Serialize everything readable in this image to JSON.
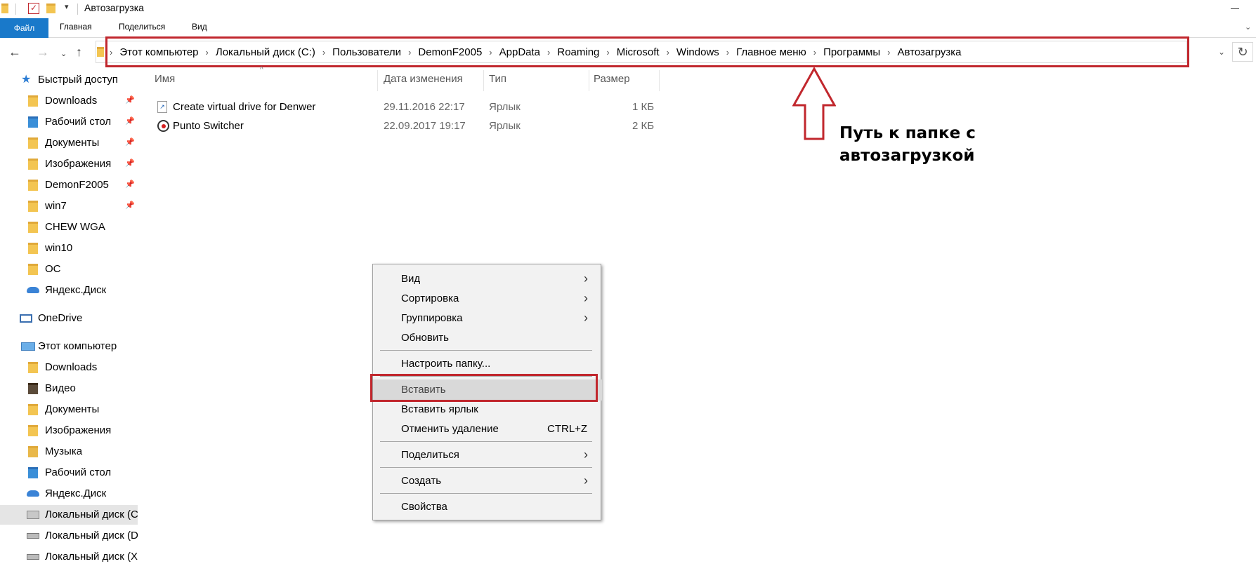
{
  "window": {
    "title": "Автозагрузка"
  },
  "ribbon": {
    "tabs": [
      "Файл",
      "Главная",
      "Поделиться",
      "Вид"
    ]
  },
  "address": {
    "crumbs": [
      "Этот компьютер",
      "Локальный диск (C:)",
      "Пользователи",
      "DemonF2005",
      "AppData",
      "Roaming",
      "Microsoft",
      "Windows",
      "Главное меню",
      "Программы",
      "Автозагрузка"
    ]
  },
  "sidebar": {
    "quick_access": "Быстрый доступ",
    "quick_items": [
      {
        "label": "Downloads",
        "icon": "download-folder-icon",
        "pinned": true
      },
      {
        "label": "Рабочий стол",
        "icon": "desktop-folder-icon",
        "pinned": true
      },
      {
        "label": "Документы",
        "icon": "documents-folder-icon",
        "pinned": true
      },
      {
        "label": "Изображения",
        "icon": "pictures-folder-icon",
        "pinned": true
      },
      {
        "label": "DemonF2005",
        "icon": "folder-icon",
        "pinned": true
      },
      {
        "label": "win7",
        "icon": "folder-icon",
        "pinned": true
      },
      {
        "label": "CHEW WGA",
        "icon": "folder-icon",
        "pinned": false
      },
      {
        "label": "win10",
        "icon": "folder-icon",
        "pinned": false
      },
      {
        "label": "OC",
        "icon": "folder-icon",
        "pinned": false
      }
    ],
    "yandex_disk": "Яндекс.Диск",
    "onedrive": "OneDrive",
    "this_pc": "Этот компьютер",
    "pc_items": [
      {
        "label": "Downloads",
        "icon": "download-folder-icon"
      },
      {
        "label": "Видео",
        "icon": "video-folder-icon"
      },
      {
        "label": "Документы",
        "icon": "documents-folder-icon"
      },
      {
        "label": "Изображения",
        "icon": "pictures-folder-icon"
      },
      {
        "label": "Музыка",
        "icon": "music-folder-icon"
      },
      {
        "label": "Рабочий стол",
        "icon": "desktop-folder-icon"
      },
      {
        "label": "Яндекс.Диск",
        "icon": "yandex-disk-icon"
      },
      {
        "label": "Локальный диск (C",
        "icon": "system-drive-icon",
        "selected": true
      },
      {
        "label": "Локальный диск (D",
        "icon": "drive-icon"
      },
      {
        "label": "Локальный диск (X",
        "icon": "drive-icon"
      }
    ]
  },
  "columns": [
    "Имя",
    "Дата изменения",
    "Тип",
    "Размер"
  ],
  "files": [
    {
      "name": "Create virtual drive for Denwer",
      "date": "29.11.2016 22:17",
      "type": "Ярлык",
      "size": "1 КБ"
    },
    {
      "name": "Punto Switcher",
      "date": "22.09.2017 19:17",
      "type": "Ярлык",
      "size": "2 КБ"
    }
  ],
  "context_menu": {
    "view": "Вид",
    "sort": "Сортировка",
    "group": "Группировка",
    "refresh": "Обновить",
    "customize": "Настроить папку...",
    "paste": "Вставить",
    "paste_shortcut": "Вставить ярлык",
    "undo_delete": "Отменить удаление",
    "undo_shortcut": "CTRL+Z",
    "share": "Поделиться",
    "create": "Создать",
    "properties": "Свойства"
  },
  "annotation": {
    "line1": "Путь к папке с",
    "line2": "автозагрузкой",
    "color": "#c1272d"
  }
}
